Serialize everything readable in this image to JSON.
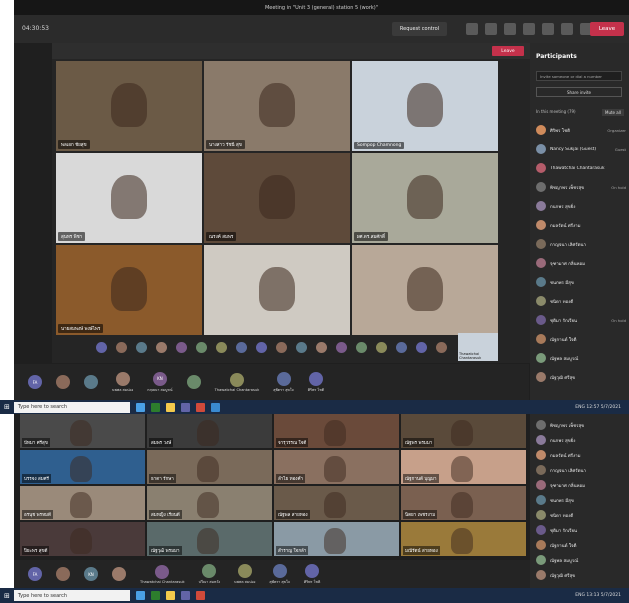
{
  "window": {
    "title": "Meeting in \"Unit 3 (general) station 5 (work)\""
  },
  "toolbar": {
    "timer": "04:30:53",
    "request_control": "Request control",
    "leave": "Leave"
  },
  "inner_window": {
    "leave": "Leave"
  },
  "video_tiles": [
    {
      "label": "พลเอก ชัยสุข",
      "bg": "#6b5a46"
    },
    {
      "label": "นางสาว รัชนี สุข",
      "bg": "#8a7a6a"
    },
    {
      "label": "Sompop Chamnong",
      "bg": "#c9d2db"
    },
    {
      "label": "สุนทร พิชา",
      "bg": "#d9d9d9"
    },
    {
      "label": "ณรงค์ สมพร",
      "bg": "#5e4a3a"
    },
    {
      "label": "ผศ.ดร.สมศักดิ์",
      "bg": "#a9a99a"
    },
    {
      "label": "นายสมพงษ์ พงษ์ไพร",
      "bg": "#8b5a2b"
    },
    {
      "label": "",
      "bg": "#cfcac2"
    },
    {
      "label": "",
      "bg": "#b8a898"
    }
  ],
  "inner_strip_label": "Thawatchai Chantarasuk",
  "participants": {
    "title": "Participants",
    "search_placeholder": "Invite someone or dial a number",
    "share_invite": "Share invite",
    "section": "In this meeting (79)",
    "mute_all": "Mute all",
    "items": [
      {
        "name": "ศิริพร โชติ",
        "status": "Organizer",
        "color": "#d08b5b"
      },
      {
        "name": "Nancy Sukjai (Guest)",
        "status": "Guest",
        "color": "#7a8fa6"
      },
      {
        "name": "Thawatchai Chantarasuk",
        "status": "",
        "color": "#b55c6a"
      },
      {
        "name": "พิชญาพร เพ็ชรสุข",
        "status": "On hold",
        "color": "#6e6e6e"
      },
      {
        "name": "กนกพร สุขยิ่ง",
        "status": "",
        "color": "#8a7a9a"
      },
      {
        "name": "กมลรัตน์ ศรีงาม",
        "status": "",
        "color": "#c08a6a"
      },
      {
        "name": "กาญจนา เลิศรัตนา",
        "status": "",
        "color": "#7a6a5a"
      },
      {
        "name": "จุฑามาศ กลิ่นหอม",
        "status": "",
        "color": "#9a6a7a"
      },
      {
        "name": "ชนกพร มีสุข",
        "status": "",
        "color": "#5a7a8a"
      },
      {
        "name": "ชนิดา ทองดี",
        "status": "",
        "color": "#8a8a6a"
      },
      {
        "name": "ชุติมา รักเรียน",
        "status": "On hold",
        "color": "#6a5a8a"
      },
      {
        "name": "ณัฐกานต์ ใจดี",
        "status": "",
        "color": "#a87a5a"
      },
      {
        "name": "ณัฐพล สมบูรณ์",
        "status": "",
        "color": "#7a9a7a"
      },
      {
        "name": "ณัฐวุฒิ ศรีสุข",
        "status": "",
        "color": "#9a7a6a"
      }
    ]
  },
  "bottom_strip": [
    {
      "initials": "FA",
      "name": ""
    },
    {
      "initials": "",
      "name": ""
    },
    {
      "initials": "",
      "name": ""
    },
    {
      "initials": "",
      "name": "นพพล สมปอง"
    },
    {
      "initials": "KN",
      "name": "กฤษณา สมบูรณ์"
    },
    {
      "initials": "",
      "name": ""
    },
    {
      "initials": "",
      "name": "Thawatchai Chantarasuk"
    },
    {
      "initials": "",
      "name": "สุพัตรา สุขใจ"
    },
    {
      "initials": "",
      "name": "ศิริพร โชติ"
    }
  ],
  "taskbar": {
    "search": "Type here to search",
    "time": "12:57",
    "date": "5/7/2021",
    "lang": "ENG"
  },
  "lower_tiles": [
    {
      "label": "ปัทมา ศรีสุข",
      "bg": "#4a4a4a"
    },
    {
      "label": "สมพร วงษ์",
      "bg": "#3b3b3b"
    },
    {
      "label": "จารุวรรณ ใจดี",
      "bg": "#6a4a3a"
    },
    {
      "label": "ณัฐพร พรมมา",
      "bg": "#5a4a3a"
    },
    {
      "label": "บรรจง สมศรี",
      "bg": "#2f5f8f"
    },
    {
      "label": "ธาดา รักษา",
      "bg": "#7a6a5a"
    },
    {
      "label": "ลำไย ทองคำ",
      "bg": "#8a7060"
    },
    {
      "label": "ณัฐกานต์ บุญมา",
      "bg": "#c7a08a"
    },
    {
      "label": "อรนุช พรหมดี",
      "bg": "#9a8a7a"
    },
    {
      "label": "สมหญิง เรียนดี",
      "bg": "#8a8070"
    },
    {
      "label": "ณัฐพล สายทอง",
      "bg": "#6a5a4a"
    },
    {
      "label": "นิตยา เพชรงาม",
      "bg": "#7a6050"
    },
    {
      "label": "ปิยะพร สุขดี",
      "bg": "#4a3a3a"
    },
    {
      "label": "ณัฐวุฒิ พรมมา",
      "bg": "#5a6a6a"
    },
    {
      "label": "สำราญ ใจกล้า",
      "bg": "#8a9aa5"
    },
    {
      "label": "มณีรัตน์ สายทอง",
      "bg": "#9a7a3a"
    }
  ],
  "lower_strip": [
    {
      "initials": "FA",
      "name": ""
    },
    {
      "initials": "",
      "name": ""
    },
    {
      "initials": "KN",
      "name": ""
    },
    {
      "initials": "",
      "name": ""
    },
    {
      "initials": "",
      "name": "Thawatchai Chantarasuk"
    },
    {
      "initials": "",
      "name": "ปวีณา สมหวัง"
    },
    {
      "initials": "",
      "name": "นพพล สมปอง"
    },
    {
      "initials": "",
      "name": "สุพัตรา สุขใจ"
    },
    {
      "initials": "",
      "name": "ศิริพร โชติ"
    }
  ],
  "taskbar2": {
    "search": "Type here to search",
    "time": "13:13",
    "date": "5/7/2021",
    "lang": "ENG"
  }
}
